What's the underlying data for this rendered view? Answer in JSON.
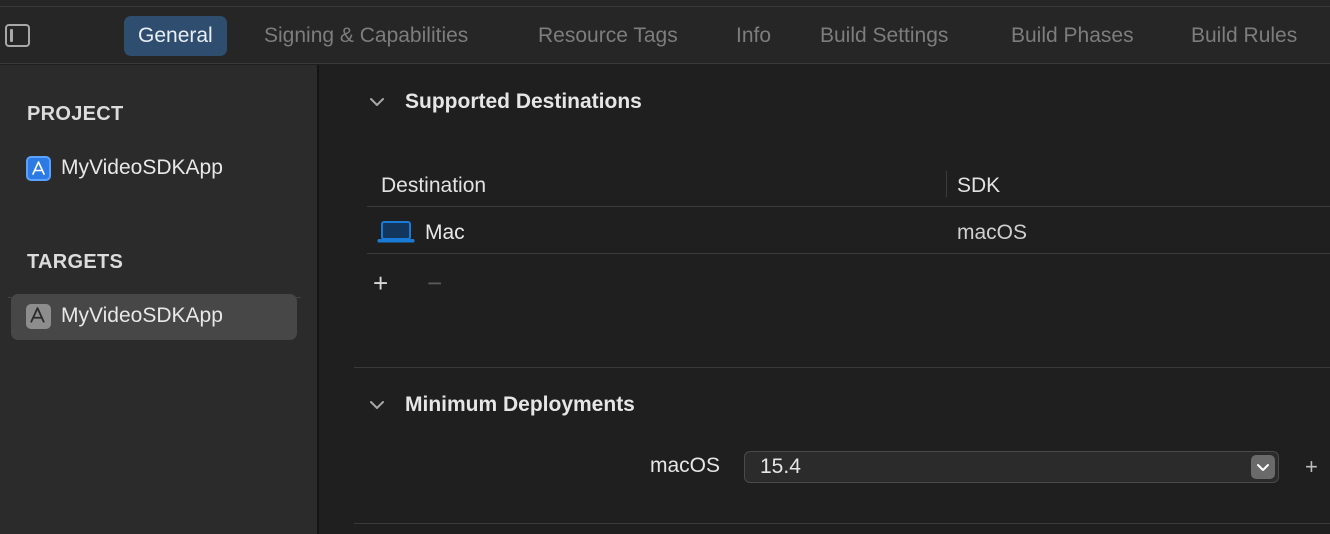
{
  "tabs": [
    {
      "label": "General",
      "active": true
    },
    {
      "label": "Signing & Capabilities"
    },
    {
      "label": "Resource Tags"
    },
    {
      "label": "Info"
    },
    {
      "label": "Build Settings"
    },
    {
      "label": "Build Phases"
    },
    {
      "label": "Build Rules"
    }
  ],
  "sidebar": {
    "project_heading": "PROJECT",
    "project_item": "MyVideoSDKApp",
    "targets_heading": "TARGETS",
    "target_item": "MyVideoSDKApp"
  },
  "supported_destinations": {
    "title": "Supported Destinations",
    "columns": [
      "Destination",
      "SDK"
    ],
    "rows": [
      {
        "destination": "Mac",
        "sdk": "macOS",
        "icon": "laptop-icon"
      }
    ],
    "add_label": "+",
    "remove_label": "−"
  },
  "minimum_deployments": {
    "title": "Minimum Deployments",
    "platform_label": "macOS",
    "version": "15.4",
    "add_label": "+"
  },
  "colors": {
    "accent_tab": "#2f4d6e",
    "laptop_blue": "#1a7bd6",
    "selected_item": "#474747"
  }
}
